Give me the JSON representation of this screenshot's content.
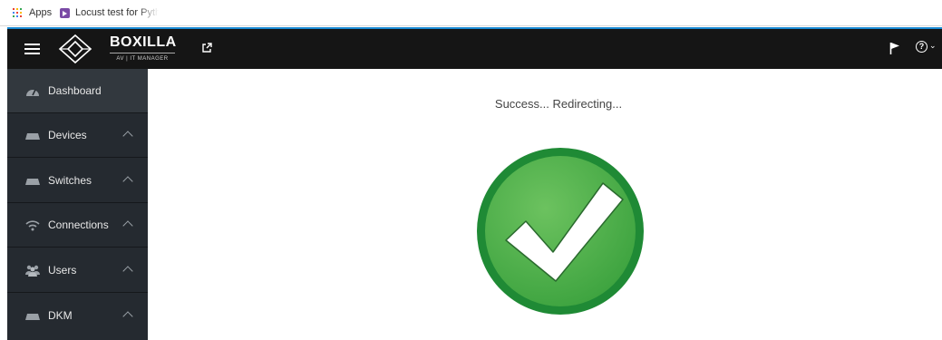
{
  "bookmarks": {
    "apps_label": "Apps",
    "link_label": "Locust test for Pytho",
    "link_icon": "bookmark-folder-icon"
  },
  "header": {
    "brand_name": "BOXILLA",
    "brand_subtitle": "AV | IT MANAGER",
    "accent_color": "#1a8ad3",
    "background_color": "#151515",
    "icons": [
      "menu-icon",
      "boxilla-logo-icon",
      "external-link-icon",
      "flag-icon",
      "help-icon"
    ]
  },
  "sidebar": {
    "items": [
      {
        "label": "Dashboard",
        "icon": "dashboard-icon",
        "expandable": false
      },
      {
        "label": "Devices",
        "icon": "devices-icon",
        "expandable": true
      },
      {
        "label": "Switches",
        "icon": "switches-icon",
        "expandable": true
      },
      {
        "label": "Connections",
        "icon": "wifi-icon",
        "expandable": true
      },
      {
        "label": "Users",
        "icon": "users-icon",
        "expandable": true
      },
      {
        "label": "DKM",
        "icon": "dkm-icon",
        "expandable": true
      }
    ]
  },
  "main": {
    "status_text": "Success... Redirecting...",
    "status_icon": "success-check-icon",
    "success_color": "#3ba444"
  }
}
